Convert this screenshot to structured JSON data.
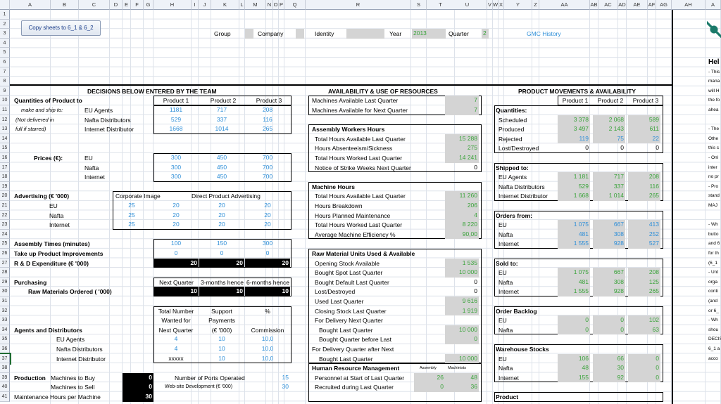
{
  "columns": [
    "A",
    "B",
    "C",
    "D",
    "E",
    "F",
    "G",
    "H",
    "I",
    "J",
    "K",
    "L",
    "M",
    "N",
    "O",
    "P",
    "Q",
    "R",
    "S",
    "T",
    "U",
    "V",
    "W",
    "X",
    "Y",
    "Z",
    "AA",
    "AB",
    "AC",
    "AD",
    "AE",
    "AF",
    "AG",
    "AH",
    "A"
  ],
  "rows": [
    "1",
    "2",
    "3",
    "4",
    "5",
    "6",
    "7",
    "8",
    "9",
    "10",
    "11",
    "12",
    "13",
    "14",
    "15",
    "16",
    "17",
    "18",
    "19",
    "20",
    "21",
    "22",
    "23",
    "24",
    "25",
    "26",
    "27",
    "28",
    "29",
    "30",
    "31",
    "32",
    "33",
    "34",
    "35",
    "36",
    "37",
    "38",
    "39",
    "40",
    "41"
  ],
  "button": "Copy sheets to 6_1 & 6_2",
  "header": {
    "group": "Group",
    "company": "Company",
    "identity": "Identity",
    "year": "Year",
    "year_val": "2013",
    "quarter": "Quarter",
    "quarter_val": "2",
    "gmc_history": "GMC History"
  },
  "decisions": {
    "title": "DECISIONS BELOW ENTERED BY THE TEAM",
    "qty_label": "Quantities of Product to",
    "make_ship": "make and ship to:",
    "not_delivered": "(Not delivered in",
    "full_starred": "full if starred)",
    "products": [
      "Product 1",
      "Product 2",
      "Product 3"
    ],
    "markets": [
      "EU Agents",
      "Nafta Distributors",
      "Internet Distributor"
    ],
    "qty": [
      [
        "1181",
        "717",
        "208"
      ],
      [
        "529",
        "337",
        "116"
      ],
      [
        "1668",
        "1014",
        "265"
      ]
    ],
    "prices_label": "Prices (€):",
    "price_markets": [
      "EU",
      "Nafta",
      "Internet"
    ],
    "prices": [
      [
        "300",
        "450",
        "700"
      ],
      [
        "300",
        "450",
        "700"
      ],
      [
        "300",
        "450",
        "700"
      ]
    ],
    "adv_label": "Advertising (€ '000)",
    "corp_image": "Corporate Image",
    "direct_adv": "Direct Product Advertising",
    "adv_markets": [
      "EU",
      "Nafta",
      "Internet"
    ],
    "adv": [
      [
        "25",
        "20",
        "20",
        "20"
      ],
      [
        "25",
        "20",
        "20",
        "20"
      ],
      [
        "25",
        "20",
        "20",
        "20"
      ]
    ],
    "assembly_label": "Assembly Times (minutes)",
    "assembly": [
      "100",
      "150",
      "300"
    ],
    "improve_label": "Take up Product Improvements",
    "improve": [
      "0",
      "0",
      "0"
    ],
    "rd_label": "R & D Expenditure (€ '000)",
    "rd": [
      "20",
      "20",
      "20"
    ],
    "purchasing": "Purchasing",
    "raw_label": "Raw Materials Ordered ( '000)",
    "raw_heads": [
      "Next Quarter",
      "3-months hence",
      "6-months hence"
    ],
    "raw": [
      "10",
      "10",
      "10"
    ],
    "agents_label": "Agents and Distributors",
    "agent_rows": [
      "EU Agents",
      "Nafta Distributors",
      "Internet Distributor"
    ],
    "agent_heads": [
      [
        "Total Number",
        "Wanted for",
        "Next Quarter"
      ],
      [
        "Support",
        "Payments",
        "(€ '000)"
      ],
      [
        "%",
        "",
        "Commission"
      ]
    ],
    "agents": [
      [
        "4",
        "10",
        "10,0"
      ],
      [
        "4",
        "10",
        "10,0"
      ],
      [
        "xxxxx",
        "10",
        "10,0"
      ]
    ],
    "production": "Production",
    "machines_buy": "Machines to Buy",
    "machines_sell": "Machines to Sell",
    "maint": "Maintenance Hours per Machine",
    "prod_vals": [
      "0",
      "0",
      "30"
    ],
    "ports": "Number of Ports Operated",
    "ports_val": "15",
    "website": "Web-site Development (€ '000)",
    "website_val": "30"
  },
  "resources": {
    "title": "AVAILABILITY & USE OF RESOURCES",
    "items": [
      [
        "Machines Available Last Quarter",
        "7",
        "g"
      ],
      [
        "Machines Available for Next Quarter",
        "7",
        "g"
      ],
      [
        "",
        "",
        ""
      ],
      [
        "Assembly Workers Hours",
        "",
        "h"
      ],
      [
        "Total Hours Available Last Quarter",
        "15 288",
        "g"
      ],
      [
        "Hours Absenteeism/Sickness",
        "275",
        "g"
      ],
      [
        "Total Hours Worked Last Quarter",
        "14 241",
        "g"
      ],
      [
        "Notice of Strike Weeks Next Quarter",
        "0",
        "w"
      ],
      [
        "",
        "",
        ""
      ],
      [
        "Machine Hours",
        "",
        "h"
      ],
      [
        "Total Hours Available Last Quarter",
        "11 260",
        "g"
      ],
      [
        "Hours Breakdown",
        "206",
        "g"
      ],
      [
        "Hours Planned Maintenance",
        "4",
        "g"
      ],
      [
        "Total Hours Worked Last Quarter",
        "8 220",
        "g"
      ],
      [
        "Average Machine Efficiency %",
        "90,00",
        "g"
      ],
      [
        "",
        "",
        ""
      ],
      [
        "Raw Material Units Used & Available",
        "",
        "h"
      ],
      [
        "Opening Stock Available",
        "1 535",
        "g"
      ],
      [
        "Bought Spot Last Quarter",
        "10 000",
        "g"
      ],
      [
        "Bought Default Last Quarter",
        "0",
        "w"
      ],
      [
        "Lost/Destroyed",
        "0",
        "w"
      ],
      [
        "Used Last Quarter",
        "9 616",
        "g"
      ],
      [
        "Closing Stock Last Quarter",
        "1 919",
        "g"
      ],
      [
        "For Delivery Next Quarter",
        "",
        ""
      ],
      [
        "Bought Last Quarter",
        "10 000",
        "g"
      ],
      [
        "Bought Quarter before Last",
        "0",
        "g"
      ],
      [
        "For Delivery Quarter after Next",
        "",
        ""
      ],
      [
        "Bought Last Quarter",
        "10 000",
        "g"
      ]
    ],
    "hr_title": "Human Resource Management",
    "hr_heads": [
      "Assembly",
      "Machinists"
    ],
    "hr_rows": [
      [
        "Personnel at Start of Last Quarter",
        "26",
        "48"
      ],
      [
        "Recruited during Last Quarter",
        "0",
        "36"
      ]
    ]
  },
  "movements": {
    "title": "PRODUCT MOVEMENTS & AVAILABILITY",
    "products": [
      "Product 1",
      "Product 2",
      "Product 3"
    ],
    "sections": [
      {
        "label": "Quantities:",
        "row": 11,
        "items": [
          [
            "Scheduled",
            "3 378",
            "2 068",
            "589"
          ],
          [
            "Produced",
            "3 497",
            "2 143",
            "611"
          ],
          [
            "Rejected",
            "119",
            "75",
            "22"
          ],
          [
            "Lost/Destroyed",
            "0",
            "0",
            "0"
          ]
        ]
      },
      {
        "label": "Shipped to:",
        "row": 17,
        "items": [
          [
            "EU Agents",
            "1 181",
            "717",
            "208"
          ],
          [
            "Nafta Distributors",
            "529",
            "337",
            "116"
          ],
          [
            "Internet Distributor",
            "1 668",
            "1 014",
            "265"
          ]
        ]
      },
      {
        "label": "Orders from:",
        "row": 22,
        "items": [
          [
            "EU",
            "1 075",
            "667",
            "413"
          ],
          [
            "Nafta",
            "481",
            "308",
            "252"
          ],
          [
            "Internet",
            "1 555",
            "928",
            "527"
          ]
        ]
      },
      {
        "label": "Sold to:",
        "row": 27,
        "items": [
          [
            "EU",
            "1 075",
            "667",
            "208"
          ],
          [
            "Nafta",
            "481",
            "308",
            "125"
          ],
          [
            "Internet",
            "1 555",
            "928",
            "265"
          ]
        ]
      },
      {
        "label": "Order Backlog",
        "row": 32,
        "items": [
          [
            "EU",
            "0",
            "0",
            "102"
          ],
          [
            "Nafta",
            "0",
            "0",
            "63"
          ]
        ]
      },
      {
        "label": "Warehouse Stocks",
        "row": 36,
        "items": [
          [
            "EU",
            "106",
            "66",
            "0"
          ],
          [
            "Nafta",
            "48",
            "30",
            "0"
          ],
          [
            "Internet",
            "155",
            "92",
            "0"
          ]
        ]
      },
      {
        "label": "Product",
        "row": 41,
        "items": []
      }
    ]
  },
  "side": {
    "title": "Hel",
    "lines": [
      "- This",
      "mana",
      "will H",
      "the fo",
      "ahea",
      "",
      "- The",
      "Othe",
      "this c",
      "- Onl",
      "inter",
      "no pr",
      "- Pro",
      "stand",
      "MAJ",
      "",
      "- Wh",
      "butto",
      "and 6",
      "for th",
      "(6_1",
      "- Unt",
      "orga",
      "conti",
      "(and",
      "or 6_",
      "- Wh",
      "shou",
      "DECIS",
      "6_1 a",
      "acco"
    ]
  }
}
